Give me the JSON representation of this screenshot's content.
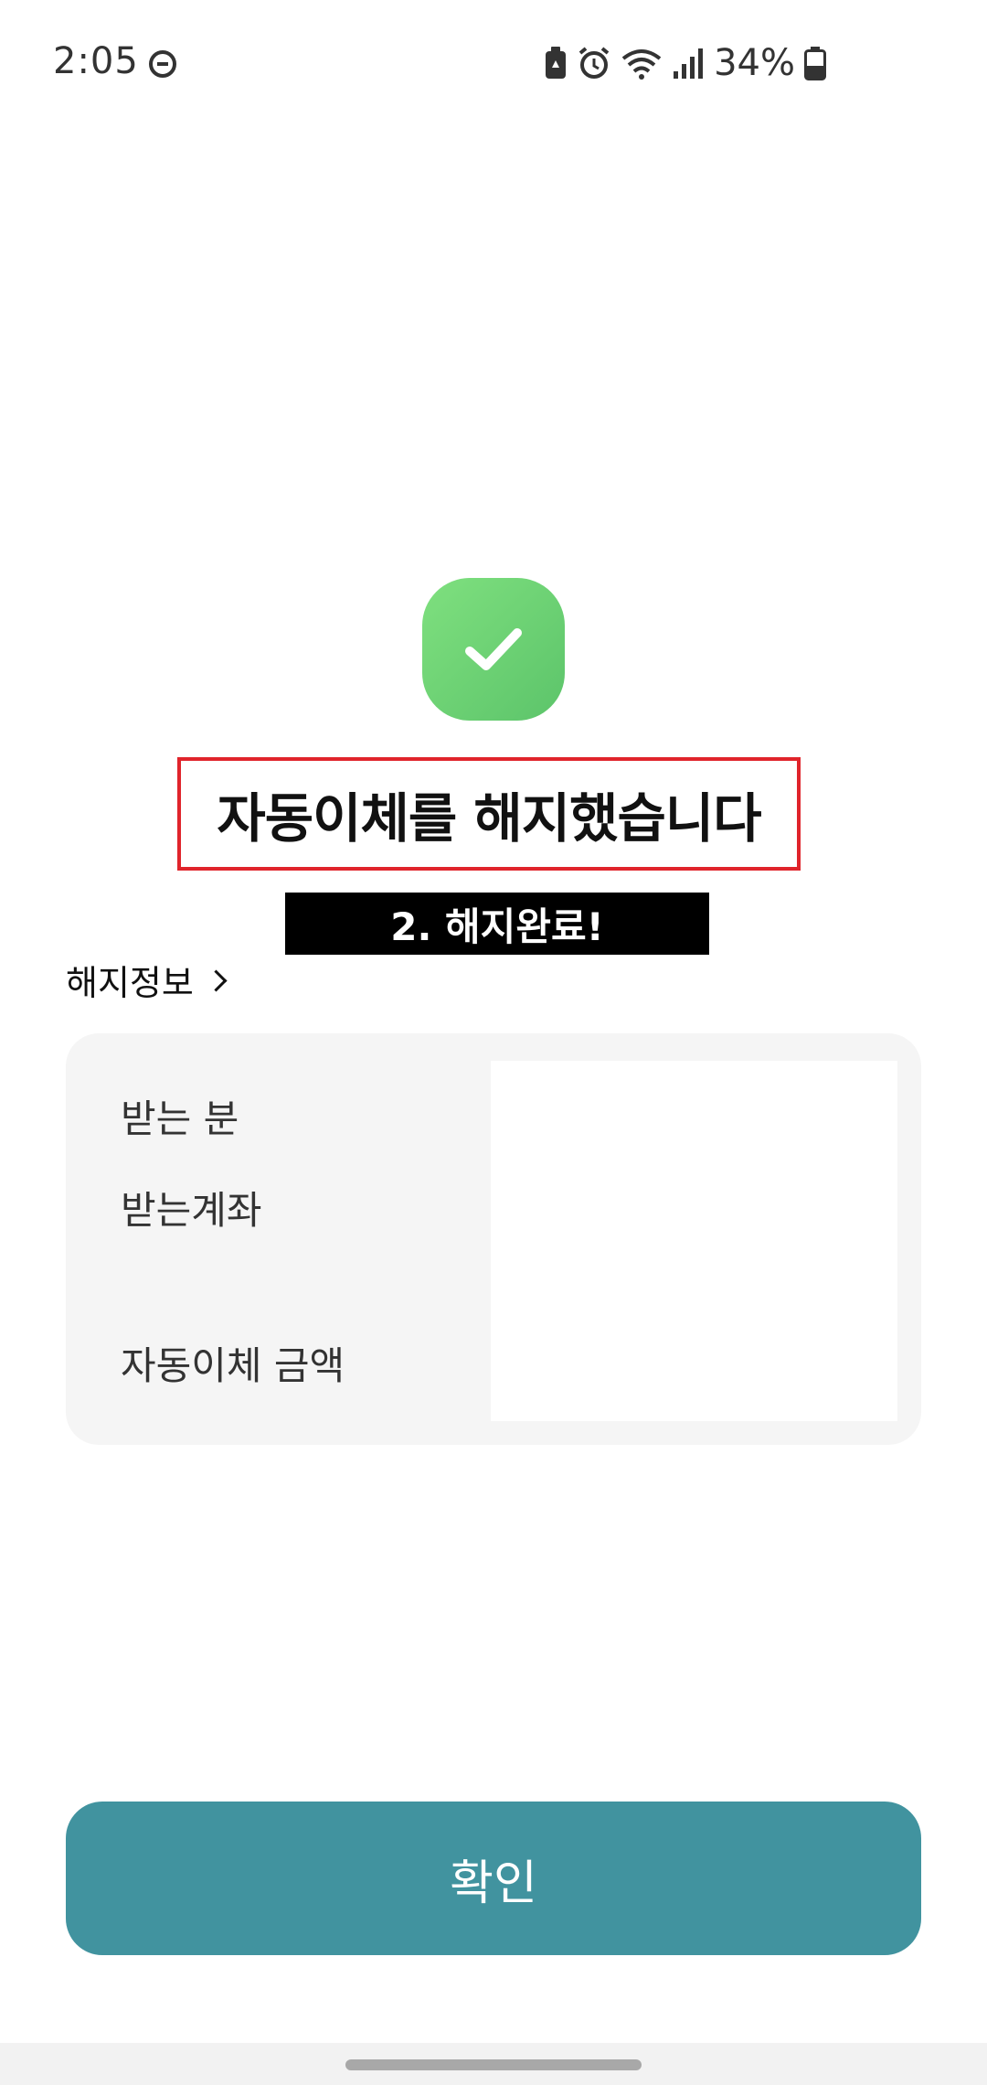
{
  "status_bar": {
    "time": "2:05",
    "battery_percent": "34%",
    "icons": [
      "do-not-disturb-icon",
      "battery-saver-icon",
      "alarm-icon",
      "wifi-icon",
      "signal-icon",
      "battery-icon"
    ]
  },
  "result": {
    "icon": "checkmark-icon",
    "icon_color": "#6bd174",
    "title": "자동이체를 해지했습니다"
  },
  "annotation": {
    "box_color": "#e0242b",
    "banner_text": "2. 해지완료!"
  },
  "section": {
    "header": "해지정보"
  },
  "info": {
    "receiver_label": "받는 분",
    "account_label": "받는계좌",
    "amount_label": "자동이체 금액"
  },
  "actions": {
    "confirm_label": "확인",
    "confirm_color": "#41939f"
  }
}
